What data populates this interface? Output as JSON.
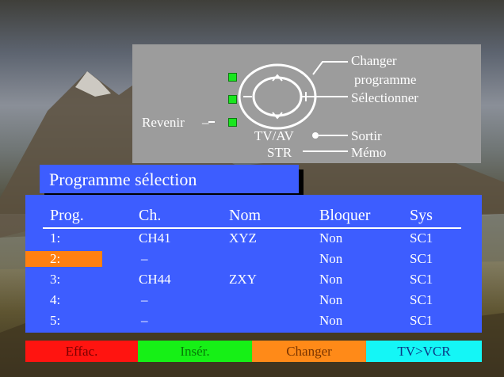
{
  "remote_help": {
    "changer_programme_line1": "Changer",
    "changer_programme_line2": "programme",
    "selectionner": "Sélectionner",
    "revenir": "Revenir",
    "tv_av": "TV/AV",
    "str": "STR",
    "sortir": "Sortir",
    "memo": "Mémo"
  },
  "title": "Programme sélection",
  "columns": [
    "Prog.",
    "Ch.",
    "Nom",
    "Bloquer",
    "Sys"
  ],
  "rows": [
    {
      "prog": "1:",
      "ch": "CH41",
      "nom": "XYZ",
      "bloquer": "Non",
      "sys": "SC1"
    },
    {
      "prog": "2:",
      "ch": "–",
      "nom": "",
      "bloquer": "Non",
      "sys": "SC1",
      "selected": true
    },
    {
      "prog": "3:",
      "ch": "CH44",
      "nom": "ZXY",
      "bloquer": "Non",
      "sys": "SC1"
    },
    {
      "prog": "4:",
      "ch": "–",
      "nom": "",
      "bloquer": "Non",
      "sys": "SC1"
    },
    {
      "prog": "5:",
      "ch": "–",
      "nom": "",
      "bloquer": "Non",
      "sys": "SC1"
    }
  ],
  "buttons": {
    "effac": "Effac.",
    "inser": "Insér.",
    "changer": "Changer",
    "tv_vcr": "TV>VCR"
  },
  "colors": {
    "panel_blue": "#3d5dff",
    "highlight_orange": "#ff8010",
    "button_red": "#ff1410",
    "button_green": "#16f016",
    "button_orange": "#ff8a18",
    "button_cyan": "#14f6f6"
  }
}
